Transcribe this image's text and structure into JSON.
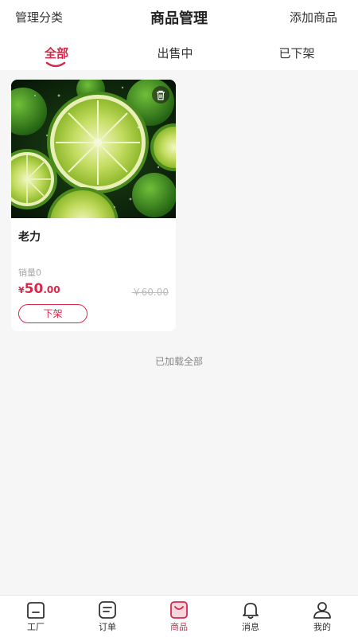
{
  "header": {
    "left_label": "管理分类",
    "title": "商品管理",
    "right_label": "添加商品"
  },
  "tabs": [
    {
      "label": "全部",
      "active": true
    },
    {
      "label": "出售中",
      "active": false
    },
    {
      "label": "已下架",
      "active": false
    }
  ],
  "products": [
    {
      "name": "老力",
      "sales": "销量0",
      "price_currency": "¥",
      "price_integer": "50",
      "price_decimal": ".00",
      "original_price": "￥60.00",
      "action_label": "下架",
      "image": "lime-slices-photo"
    }
  ],
  "list_footer": "已加载全部",
  "tabbar": [
    {
      "label": "工厂",
      "icon": "factory-icon",
      "active": false
    },
    {
      "label": "订单",
      "icon": "order-icon",
      "active": false
    },
    {
      "label": "商品",
      "icon": "goods-icon",
      "active": true
    },
    {
      "label": "消息",
      "icon": "bell-icon",
      "active": false
    },
    {
      "label": "我的",
      "icon": "user-icon",
      "active": false
    }
  ],
  "colors": {
    "accent": "#d6294a",
    "background": "#f6f6f6"
  }
}
